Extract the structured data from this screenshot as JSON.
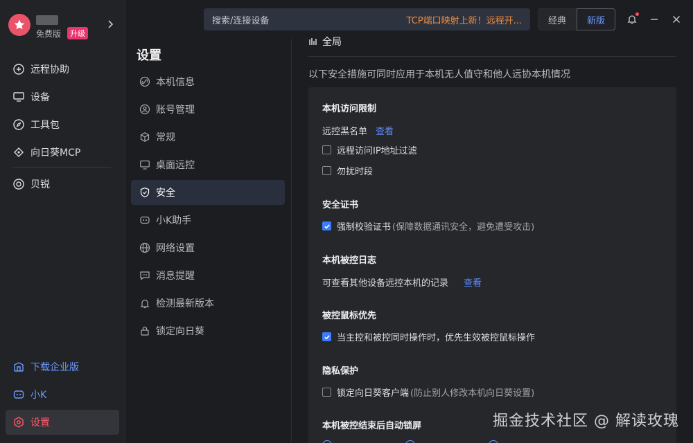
{
  "profile": {
    "edition": "免费版",
    "upgrade": "升级"
  },
  "nav": {
    "items": [
      {
        "label": "远程协助",
        "icon": "remote-assist-icon"
      },
      {
        "label": "设备",
        "icon": "monitor-icon"
      },
      {
        "label": "工具包",
        "icon": "compass-icon"
      },
      {
        "label": "向日葵MCP",
        "icon": "mcp-icon"
      },
      {
        "label": "贝锐",
        "icon": "beirui-icon"
      }
    ],
    "bottom": [
      {
        "label": "下载企业版",
        "icon": "enterprise-icon"
      },
      {
        "label": "小K",
        "icon": "robot-icon"
      },
      {
        "label": "设置",
        "icon": "settings-hex-icon"
      }
    ]
  },
  "topbar": {
    "search_placeholder": "搜索/连接设备",
    "promo": "TCP端口映射上新！远程开...",
    "classic": "经典",
    "new": "新版"
  },
  "settings": {
    "title": "设置",
    "items": [
      {
        "label": "本机信息",
        "icon": "link-icon"
      },
      {
        "label": "账号管理",
        "icon": "account-icon"
      },
      {
        "label": "常规",
        "icon": "cube-icon"
      },
      {
        "label": "桌面远控",
        "icon": "desktop-icon"
      },
      {
        "label": "安全",
        "icon": "shield-icon"
      },
      {
        "label": "小K助手",
        "icon": "robot-icon"
      },
      {
        "label": "网络设置",
        "icon": "globe-icon"
      },
      {
        "label": "消息提醒",
        "icon": "message-icon"
      },
      {
        "label": "检测最新版本",
        "icon": "update-icon"
      },
      {
        "label": "锁定向日葵",
        "icon": "lock-icon"
      }
    ]
  },
  "content": {
    "section_header": "全局",
    "intro": "以下安全措施可同时应用于本机无人值守和他人远协本机情况",
    "access_limit": {
      "title": "本机访问限制",
      "blacklist_label": "远控黑名单",
      "blacklist_link": "查看",
      "ip_filter": "远程访问IP地址过滤",
      "dnd": "勿扰时段"
    },
    "cert": {
      "title": "安全证书",
      "force_label": "强制校验证书",
      "force_note": "(保障数据通讯安全，避免遭受攻击)"
    },
    "log": {
      "title": "本机被控日志",
      "desc": "可查看其他设备远控本机的记录",
      "link": "查看"
    },
    "mouse": {
      "title": "被控鼠标优先",
      "label": "当主控和被控同时操作时，优先生效被控鼠标操作"
    },
    "privacy": {
      "title": "隐私保护",
      "lock_label": "锁定向日葵客户端",
      "lock_note": "(防止别人修改本机向日葵设置)"
    },
    "autolock": {
      "title": "本机被控结束后自动锁屏"
    }
  },
  "watermark": "掘金技术社区 @ 解读玫瑰"
}
